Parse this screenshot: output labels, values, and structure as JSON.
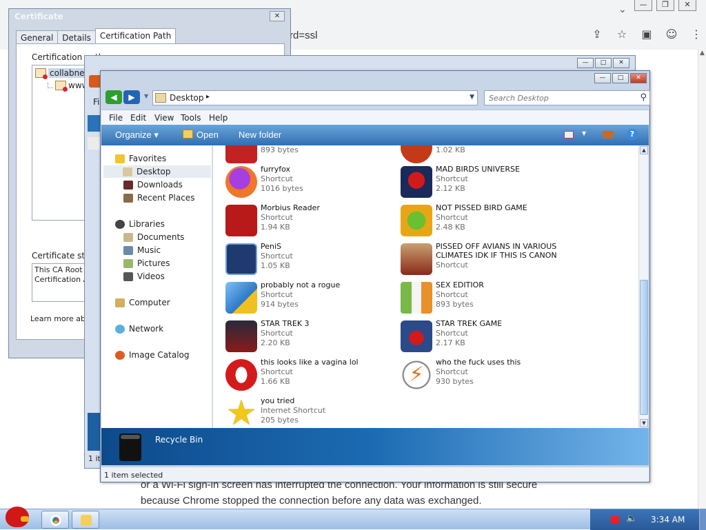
{
  "chrome": {
    "url_fragment": "rd=ssl",
    "minimize_glyph": "—",
    "restore_glyph": "❐",
    "close_glyph": "✕",
    "tab_chevron": "⌄",
    "share_glyph": "⇪",
    "star_glyph": "☆",
    "sidebar_glyph": "▣",
    "profile_glyph": "☺",
    "menu_glyph": "⋮",
    "body_text": "or a Wi-Fi sign-in screen has interrupted the connection. Your information is still secure because Chrome stopped the connection before any data was exchanged."
  },
  "certificate": {
    "title": "Certificate",
    "close_glyph": "✕",
    "tabs": [
      {
        "label": "General"
      },
      {
        "label": "Details"
      },
      {
        "label": "Certification Path"
      }
    ],
    "path_label": "Certification path",
    "tree": [
      {
        "label": "collabnet.lo"
      },
      {
        "label": "www.g"
      }
    ],
    "status_label": "Certificate status:",
    "status_text": "This CA Root cert\nCertification Auth",
    "learn_more": "Learn more about"
  },
  "bg_window": {
    "menu_fragment": "Fi",
    "status_fragment": "1 it",
    "minimize_glyph": "—",
    "maximize_glyph": "□",
    "close_glyph": "✕"
  },
  "explorer": {
    "minimize_glyph": "—",
    "maximize_glyph": "□",
    "close_glyph": "✕",
    "address": "Desktop",
    "address_chevron": "▸",
    "search_placeholder": "Search Desktop",
    "menu": [
      "File",
      "Edit",
      "View",
      "Tools",
      "Help"
    ],
    "toolbar": {
      "organize": "Organize ▾",
      "open": "Open",
      "new_folder": "New folder",
      "help": "?"
    },
    "nav": {
      "favorites": "Favorites",
      "desktop": "Desktop",
      "downloads": "Downloads",
      "recent": "Recent Places",
      "libraries": "Libraries",
      "documents": "Documents",
      "music": "Music",
      "pictures": "Pictures",
      "videos": "Videos",
      "computer": "Computer",
      "network": "Network",
      "image_catalog": "Image Catalog"
    },
    "files_left": [
      {
        "name": "",
        "type": "",
        "size": "893 bytes",
        "icon": "red-app-icon",
        "color": "#c22222"
      },
      {
        "name": "furryfox",
        "type": "Shortcut",
        "size": "1016 bytes",
        "icon": "firefox-icon",
        "color": "#e66a12"
      },
      {
        "name": "Morbius Reader",
        "type": "Shortcut",
        "size": "1.94 KB",
        "icon": "pdf-reader-icon",
        "color": "#b81a1a"
      },
      {
        "name": "PeniS",
        "type": "Shortcut",
        "size": "1.05 KB",
        "icon": "photoshop-icon",
        "color": "#1f3a6e"
      },
      {
        "name": "probably not a rogue",
        "type": "Shortcut",
        "size": "914 bytes",
        "icon": "gears-icon",
        "color": "#3c8fd8"
      },
      {
        "name": "STAR TREK 3",
        "type": "Shortcut",
        "size": "2.20 KB",
        "icon": "star-wars-game-icon",
        "color": "#6a1a1a"
      },
      {
        "name": "this looks like a vagina lol",
        "type": "Shortcut",
        "size": "1.66 KB",
        "icon": "opera-icon",
        "color": "#d31b1b"
      },
      {
        "name": "you tried",
        "type": "Internet Shortcut",
        "size": "205 bytes",
        "icon": "gold-star-icon",
        "color": "#f2c817"
      }
    ],
    "files_right": [
      {
        "name": "",
        "type": "",
        "size": "1.02 KB",
        "icon": "red-app-icon",
        "color": "#c43a18"
      },
      {
        "name": "MAD BIRDS UNIVERSE",
        "type": "Shortcut",
        "size": "2.12 KB",
        "icon": "angry-birds-space-icon",
        "color": "#233a6a"
      },
      {
        "name": "NOT PISSED BIRD GAME",
        "type": "Shortcut",
        "size": "2.48 KB",
        "icon": "green-pig-icon",
        "color": "#e8a616"
      },
      {
        "name": "PISSED OFF AVIANS IN VARIOUS CLIMATES IDK IF THIS IS CANON",
        "type": "Shortcut",
        "size": "",
        "icon": "angry-birds-seasons-icon",
        "color": "#8a4a2a"
      },
      {
        "name": "SEX EDITIOR",
        "type": "Shortcut",
        "size": "893 bytes",
        "icon": "hxd-editor-icon",
        "color": "#e8f0e0"
      },
      {
        "name": "STAR TREK GAME",
        "type": "Shortcut",
        "size": "2.17 KB",
        "icon": "star-wars-birds-icon",
        "color": "#2a4a8a"
      },
      {
        "name": "who the fuck uses this",
        "type": "Shortcut",
        "size": "930 bytes",
        "icon": "flashget-icon",
        "color": "#f0f0f0"
      }
    ],
    "details_label": "Recycle Bin",
    "status": "1 item selected"
  },
  "taskbar": {
    "clock": "3:34 AM",
    "volume_glyph": "🔈"
  },
  "colors": {
    "toolbar_blue": "#2f6fb3",
    "details_blue": "#1d6bb3",
    "window_frame": "#c8d6e8"
  }
}
